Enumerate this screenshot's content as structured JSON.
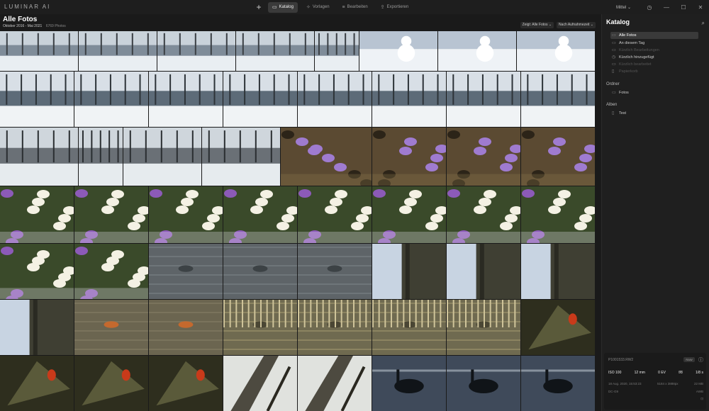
{
  "app": {
    "logo": "LUMINAR AI"
  },
  "nav": {
    "add_label": "+",
    "tabs": [
      {
        "label": "Katalog",
        "icon": "folder-icon",
        "glyph": "▭",
        "active": true
      },
      {
        "label": "Vorlagen",
        "icon": "templates-icon",
        "glyph": "✧",
        "active": false
      },
      {
        "label": "Bearbeiten",
        "icon": "edit-icon",
        "glyph": "≡",
        "active": false
      },
      {
        "label": "Exportieren",
        "icon": "export-icon",
        "glyph": "⇪",
        "active": false
      }
    ]
  },
  "toolbar": {
    "zoom": "Mittel ⌄",
    "info_glyph": "◷",
    "min_glyph": "—",
    "max_glyph": "☐",
    "close_glyph": "✕"
  },
  "header": {
    "title": "Alle Fotos",
    "date_range": "Oktober 2016 - Mai 2021",
    "count": "6769 Photos",
    "filter_show": "Zeigt: Alle Fotos ⌄",
    "filter_sort": "Nach Aufnahmezeit ⌄"
  },
  "sidebar": {
    "title": "Katalog",
    "search_glyph": "⌕",
    "items": [
      {
        "label": "Alle Fotos",
        "glyph": "▭",
        "state": "sel"
      },
      {
        "label": "An diesem Tag",
        "glyph": "▭",
        "state": ""
      },
      {
        "label": "Kürzlich Bearbeitungen",
        "glyph": "▭",
        "state": "dim"
      },
      {
        "label": "Kürzlich hinzugefügt",
        "glyph": "◷",
        "state": ""
      },
      {
        "label": "Kürzlich bearbeitet",
        "glyph": "▭",
        "state": "dim"
      },
      {
        "label": "Papierkorb",
        "glyph": "▯",
        "state": "dim"
      }
    ],
    "section_folders": "Ordner",
    "folders": [
      {
        "label": "Fotos",
        "glyph": "▭"
      }
    ],
    "section_albums": "Alben",
    "albums": [
      {
        "label": "Test",
        "glyph": "▯"
      }
    ]
  },
  "info": {
    "filename": "P1001533.RW2",
    "raw_badge": "RAW",
    "info_glyph": "ⓘ",
    "iso": "ISO 100",
    "focal": "12 mm",
    "ev": "0 EV",
    "aperture": "f/8",
    "shutter": "1/8 s",
    "date": "18 Aug. 2020, 15:53:23",
    "dims": "5184 x 3888px",
    "size": "22 MB",
    "camera": "DC-G9",
    "wb": "AWB",
    "flash_glyph": "⊡"
  },
  "grid": {
    "palette": {
      "snowlake": [
        "#7f8c99",
        "#c9d2da",
        "#3a3f44",
        "#e9eef2"
      ],
      "snowman": [
        "#b8c4d2",
        "#eef2f6",
        "#8090a0",
        "#ffffff"
      ],
      "pond": [
        "#5d6b78",
        "#d8dfe6",
        "#2d3338",
        "#f0f3f5"
      ],
      "forest": [
        "#6a7076",
        "#cfd6dc",
        "#2a2e31",
        "#e6ebee"
      ],
      "crocusground": [
        "#5b4a32",
        "#8d7a4e",
        "#2c2418",
        "#9f7bd0"
      ],
      "crocus": [
        "#3a4a2a",
        "#e9e6f0",
        "#8c5ab8",
        "#f4f1e4"
      ],
      "duck": [
        "#5e6468",
        "#7d868a",
        "#3c4245",
        "#a0a8ab"
      ],
      "tree": [
        "#3f3f33",
        "#8ea0b8",
        "#2a2a22",
        "#c8d4e2"
      ],
      "mandarin": [
        "#6b6550",
        "#8a8268",
        "#c4692e",
        "#443f30"
      ],
      "reeds": [
        "#6f6a50",
        "#a99e72",
        "#4a4634",
        "#cfc49a"
      ],
      "ladybug": [
        "#5a5a3a",
        "#a8a888",
        "#c83a1a",
        "#2e2e1e"
      ],
      "branches": [
        "#4d4a40",
        "#b4b8b0",
        "#2a2820",
        "#e0e2de"
      ],
      "goose": [
        "#3f4a5a",
        "#a8b4c4",
        "#101418",
        "#d0d8e0"
      ]
    },
    "rows": [
      {
        "cells": [
          [
            "snowlake",
            110
          ],
          [
            "snowlake",
            110
          ],
          [
            "snowlake",
            110
          ],
          [
            "snowlake",
            110
          ],
          [
            "snowlake",
            62
          ],
          [
            "snowman",
            110
          ],
          [
            "snowman",
            110
          ],
          [
            "snowman",
            110
          ]
        ]
      },
      {
        "cells": [
          [
            "pond",
            104
          ],
          [
            "pond",
            104
          ],
          [
            "pond",
            104
          ],
          [
            "pond",
            104
          ],
          [
            "pond",
            104
          ],
          [
            "pond",
            104
          ],
          [
            "pond",
            104
          ],
          [
            "pond",
            104
          ]
        ]
      },
      {
        "cells": [
          [
            "forest",
            110
          ],
          [
            "forest",
            62
          ],
          [
            "forest",
            110
          ],
          [
            "forest",
            110
          ],
          [
            "crocusground",
            128
          ],
          [
            "crocusground",
            104
          ],
          [
            "crocusground",
            104
          ],
          [
            "crocusground",
            104
          ]
        ]
      },
      {
        "cells": [
          [
            "crocus",
            104
          ],
          [
            "crocus",
            104
          ],
          [
            "crocus",
            104
          ],
          [
            "crocus",
            104
          ],
          [
            "crocus",
            104
          ],
          [
            "crocus",
            104
          ],
          [
            "crocus",
            104
          ],
          [
            "crocus",
            104
          ]
        ]
      },
      {
        "cells": [
          [
            "crocus",
            104
          ],
          [
            "crocus",
            104
          ],
          [
            "duck",
            104
          ],
          [
            "duck",
            104
          ],
          [
            "duck",
            104
          ],
          [
            "tree",
            104
          ],
          [
            "tree",
            104
          ],
          [
            "tree",
            104
          ]
        ]
      },
      {
        "cells": [
          [
            "tree",
            104
          ],
          [
            "mandarin",
            104
          ],
          [
            "mandarin",
            104
          ],
          [
            "reeds",
            104
          ],
          [
            "reeds",
            104
          ],
          [
            "reeds",
            104
          ],
          [
            "reeds",
            104
          ],
          [
            "ladybug",
            104
          ]
        ]
      },
      {
        "cells": [
          [
            "ladybug",
            104
          ],
          [
            "ladybug",
            104
          ],
          [
            "ladybug",
            104
          ],
          [
            "branches",
            104
          ],
          [
            "branches",
            104
          ],
          [
            "goose",
            104
          ],
          [
            "goose",
            104
          ],
          [
            "goose",
            104
          ]
        ]
      }
    ]
  }
}
